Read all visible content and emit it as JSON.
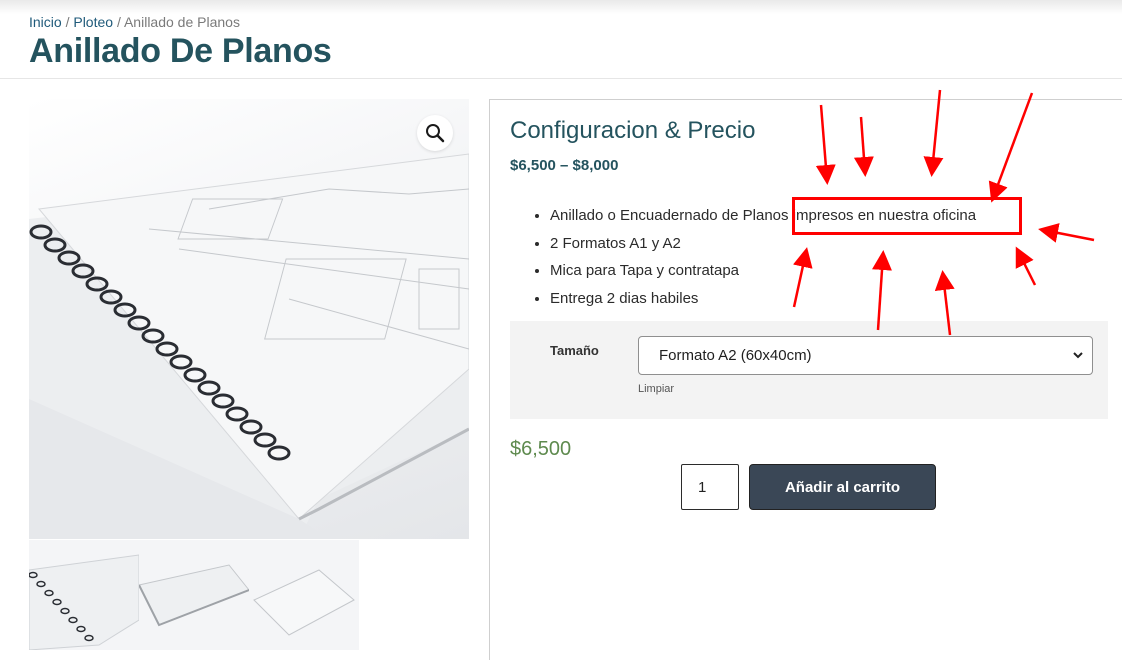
{
  "breadcrumb": {
    "home": "Inicio",
    "separator": "/",
    "category": "Ploteo",
    "current": "Anillado de Planos"
  },
  "page": {
    "title": "Anillado De Planos"
  },
  "product": {
    "section_title": "Configuracion & Precio",
    "price_range": "$6,500 – $8,000",
    "features": [
      "Anillado o Encuadernado de Planos",
      "2 Formatos A1 y A2",
      "Mica para Tapa y contratapa",
      "Entrega 2 dias habiles"
    ],
    "feature_highlight": "impresos en nuestra oficina",
    "variation": {
      "label": "Tamaño",
      "selected": "Formato A2 (60x40cm)",
      "clear_label": "Limpiar"
    },
    "current_price": "$6,500",
    "quantity": "1",
    "add_to_cart_label": "Añadir al carrito"
  },
  "icons": {
    "zoom": "magnifier-icon",
    "select": "chevron-down-icon"
  },
  "colors": {
    "title": "#24535e",
    "link": "#1f5a7a",
    "price_current": "#5e8a4e",
    "button_bg": "#3a4756",
    "annotation": "#ff0000"
  }
}
